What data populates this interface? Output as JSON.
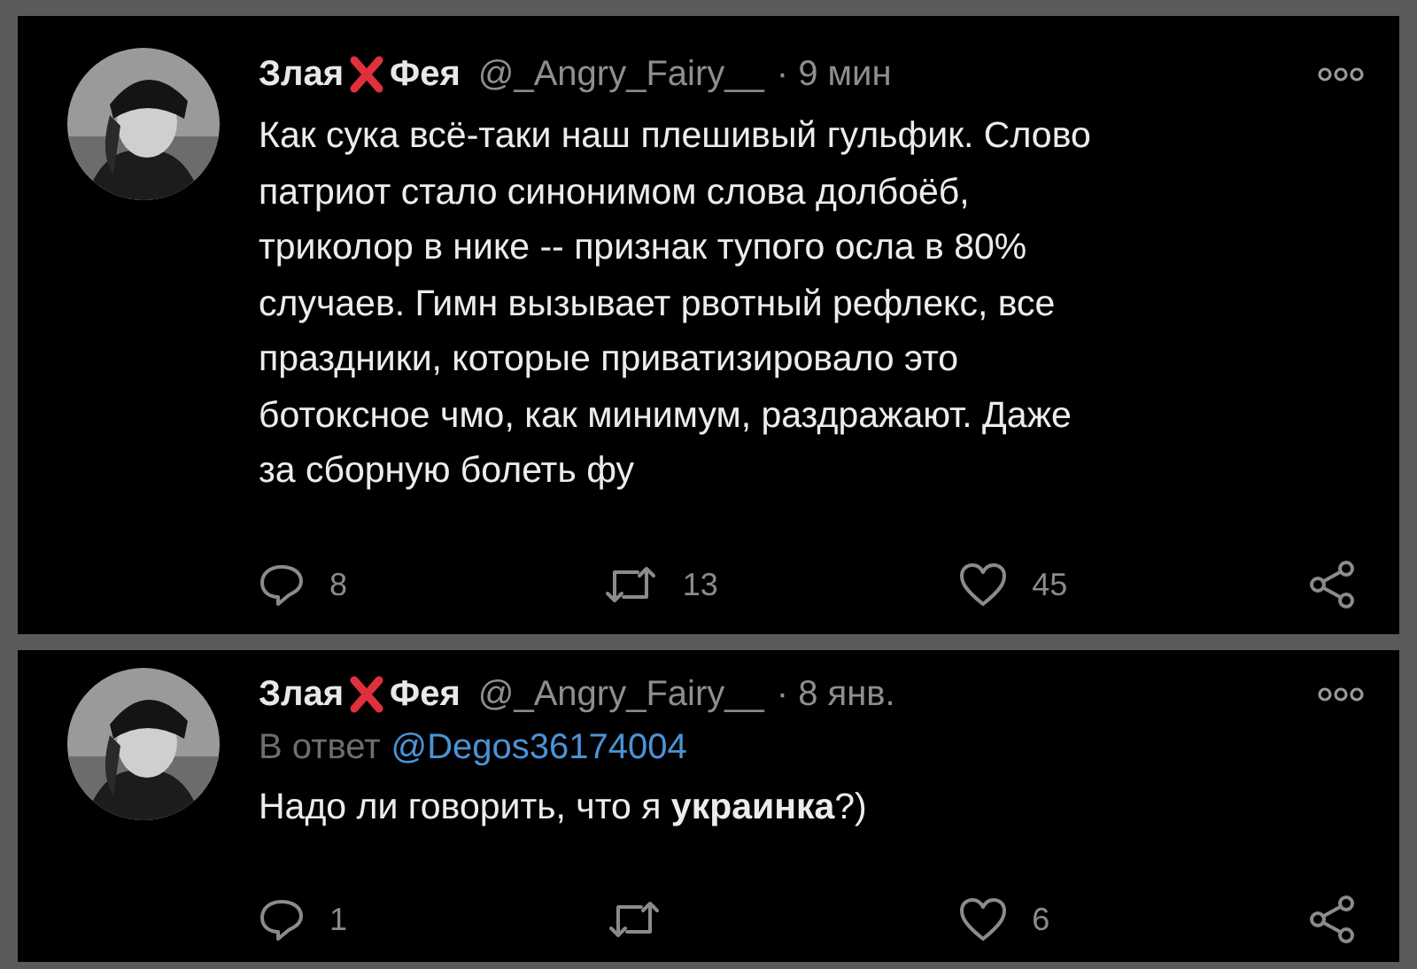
{
  "tweets": [
    {
      "name_before": "Злая",
      "name_after": "Фея",
      "handle": "@_Angry_Fairy__",
      "time": "· 9 мин",
      "text": "Как сука всё-таки наш плешивый гульфик. Слово\nпатриот стало синонимом слова долбоёб,\nтриколор в нике -- признак тупого осла в 80%\nслучаев. Гимн вызывает рвотный рефлекс, все\nпраздники, которые приватизировало это\nботоксное чмо, как минимум, раздражают. Даже\nза сборную болеть фу",
      "replies": "8",
      "retweets": "13",
      "likes": "45"
    },
    {
      "name_before": "Злая",
      "name_after": "Фея",
      "handle": "@_Angry_Fairy__",
      "time": "· 8 янв.",
      "reply_to_label": "В ответ",
      "reply_to": "@Degos36174004",
      "text": "Надо ли говорить, что я **украинка**?)",
      "replies": "1",
      "likes": "6"
    }
  ]
}
